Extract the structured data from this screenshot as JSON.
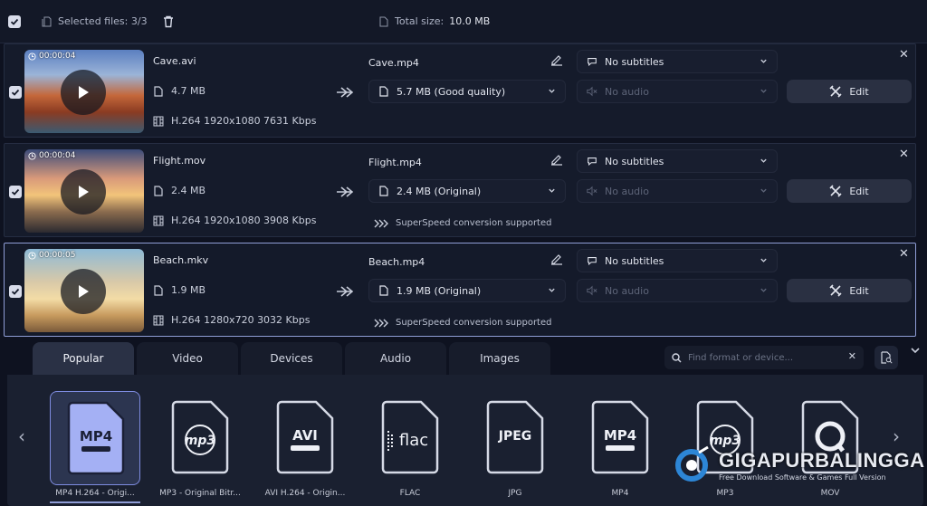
{
  "toolbar": {
    "selected_files": "Selected files: 3/3",
    "total_size_label": "Total size:",
    "total_size_value": "10.0 MB"
  },
  "files": [
    {
      "duration": "00:00:04",
      "source_name": "Cave.avi",
      "source_size": "4.7 MB",
      "source_codec": "H.264 1920x1080 7631 Kbps",
      "output_name": "Cave.mp4",
      "output_size": "5.7 MB (Good quality)",
      "subtitles": "No subtitles",
      "audio": "No audio",
      "edit_label": "Edit",
      "superspeed": ""
    },
    {
      "duration": "00:00:04",
      "source_name": "Flight.mov",
      "source_size": "2.4 MB",
      "source_codec": "H.264 1920x1080 3908 Kbps",
      "output_name": "Flight.mp4",
      "output_size": "2.4 MB (Original)",
      "subtitles": "No subtitles",
      "audio": "No audio",
      "edit_label": "Edit",
      "superspeed": "SuperSpeed conversion supported"
    },
    {
      "duration": "00:00:05",
      "source_name": "Beach.mkv",
      "source_size": "1.9 MB",
      "source_codec": "H.264 1280x720 3032 Kbps",
      "output_name": "Beach.mp4",
      "output_size": "1.9 MB (Original)",
      "subtitles": "No subtitles",
      "audio": "No audio",
      "edit_label": "Edit",
      "superspeed": "SuperSpeed conversion supported"
    }
  ],
  "tabs": [
    "Popular",
    "Video",
    "Devices",
    "Audio",
    "Images"
  ],
  "active_tab": "Popular",
  "search": {
    "placeholder": "Find format or device..."
  },
  "formats": [
    {
      "badge": "MP4",
      "label": "MP4 H.264 - Origi..."
    },
    {
      "badge": "mp3",
      "label": "MP3 - Original Bitr..."
    },
    {
      "badge": "AVI",
      "label": "AVI H.264 - Origin..."
    },
    {
      "badge": "flac",
      "label": "FLAC"
    },
    {
      "badge": "JPEG",
      "label": "JPG"
    },
    {
      "badge": "MP4",
      "label": "MP4"
    },
    {
      "badge": "mp3",
      "label": "MP3"
    },
    {
      "badge": "Q",
      "label": "MOV"
    }
  ],
  "watermark": {
    "title": "GIGAPURBALINGGA",
    "subtitle": "Free Download Software & Games Full Version"
  },
  "colors": {
    "accent": "#8f9dd6",
    "selected_format_bg": "#a4b0f4"
  }
}
